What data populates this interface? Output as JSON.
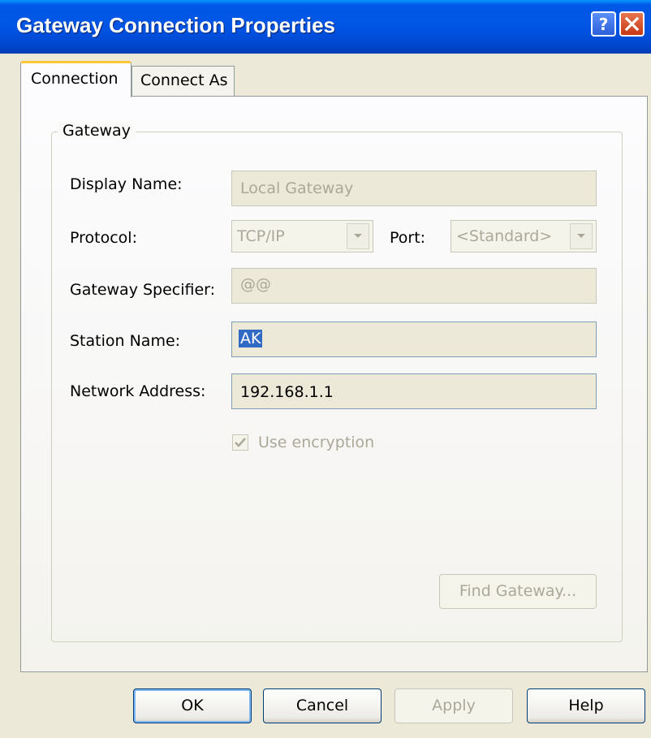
{
  "window": {
    "title": "Gateway Connection Properties"
  },
  "tabs": [
    {
      "label": "Connection",
      "selected": true
    },
    {
      "label": "Connect As",
      "selected": false
    }
  ],
  "group": {
    "label": "Gateway"
  },
  "fields": {
    "display_name": {
      "label": "Display Name:",
      "value": "Local Gateway",
      "enabled": false
    },
    "protocol": {
      "label": "Protocol:",
      "value": "TCP/IP",
      "enabled": false
    },
    "port": {
      "label": "Port:",
      "value": "<Standard>",
      "enabled": false
    },
    "gateway_specifier": {
      "label": "Gateway Specifier:",
      "value": "@@",
      "enabled": false
    },
    "station_name": {
      "label": "Station Name:",
      "value": "AK",
      "enabled": true,
      "selected_text": true
    },
    "network_address": {
      "label": "Network Address:",
      "value": "192.168.1.1",
      "enabled": true
    }
  },
  "use_encryption": {
    "label": "Use encryption",
    "checked": true,
    "enabled": false
  },
  "buttons": {
    "find_gateway": "Find Gateway...",
    "ok": "OK",
    "cancel": "Cancel",
    "apply": "Apply",
    "help": "Help"
  },
  "icons": {
    "help": "question-icon",
    "close": "close-icon",
    "dropdown": "chevron-down-icon",
    "check": "checkmark-icon"
  },
  "colors": {
    "titlebar": "#0055E5",
    "dialog_bg": "#ECE9D8",
    "selection": "#316AC5",
    "tab_highlight": "#FFC83C"
  }
}
